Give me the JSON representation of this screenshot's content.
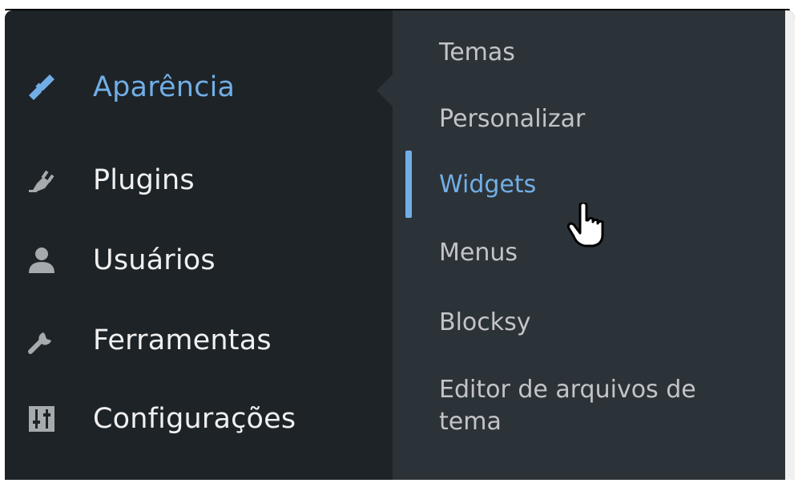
{
  "sidebar": {
    "items": [
      {
        "label": "Aparência",
        "icon": "paintbrush-icon",
        "active": true
      },
      {
        "label": "Plugins",
        "icon": "plugin-icon",
        "active": false
      },
      {
        "label": "Usuários",
        "icon": "user-icon",
        "active": false
      },
      {
        "label": "Ferramentas",
        "icon": "wrench-icon",
        "active": false
      },
      {
        "label": "Configurações",
        "icon": "settings-sliders-icon",
        "active": false
      }
    ]
  },
  "submenu": {
    "items": [
      {
        "label": "Temas"
      },
      {
        "label": "Personalizar"
      },
      {
        "label": "Widgets",
        "current": true
      },
      {
        "label": "Menus"
      },
      {
        "label": "Blocksy"
      },
      {
        "label_line1": "Editor de arquivos de",
        "label_line2": "tema"
      }
    ]
  },
  "colors": {
    "sidebar_bg": "#1d2327",
    "submenu_bg": "#2c3338",
    "accent": "#72aee6",
    "text": "#f0f0f1",
    "submenu_text": "#c3c4c7"
  },
  "cursor": {
    "icon": "hand-pointer-icon"
  }
}
